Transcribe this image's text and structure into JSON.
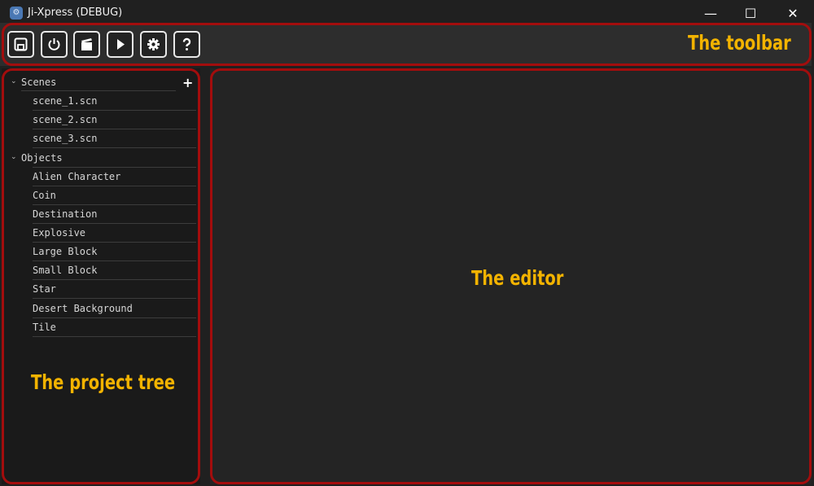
{
  "window": {
    "title": "Ji-Xpress (DEBUG)",
    "minimize_glyph": "—",
    "maximize_glyph": "☐",
    "close_glyph": "✕"
  },
  "toolbar": {
    "buttons": [
      {
        "icon": "save-icon"
      },
      {
        "icon": "power-icon"
      },
      {
        "icon": "clapperboard-icon"
      },
      {
        "icon": "play-icon"
      },
      {
        "icon": "gear-icon"
      },
      {
        "icon": "help-icon"
      }
    ]
  },
  "tree": {
    "groups": [
      {
        "label": "Scenes",
        "add_glyph": "+",
        "items": [
          "scene_1.scn",
          "scene_2.scn",
          "scene_3.scn"
        ]
      },
      {
        "label": "Objects",
        "items": [
          "Alien Character",
          "Coin",
          "Destination",
          "Explosive",
          "Large Block",
          "Small Block",
          "Star",
          "Desert Background",
          "Tile"
        ]
      }
    ]
  },
  "annotations": {
    "toolbar": "The toolbar",
    "editor": "The editor",
    "tree": "The project tree"
  },
  "colors": {
    "annotation_text": "#f3b300",
    "annotation_border": "#a30d0d",
    "background": "#202020"
  }
}
